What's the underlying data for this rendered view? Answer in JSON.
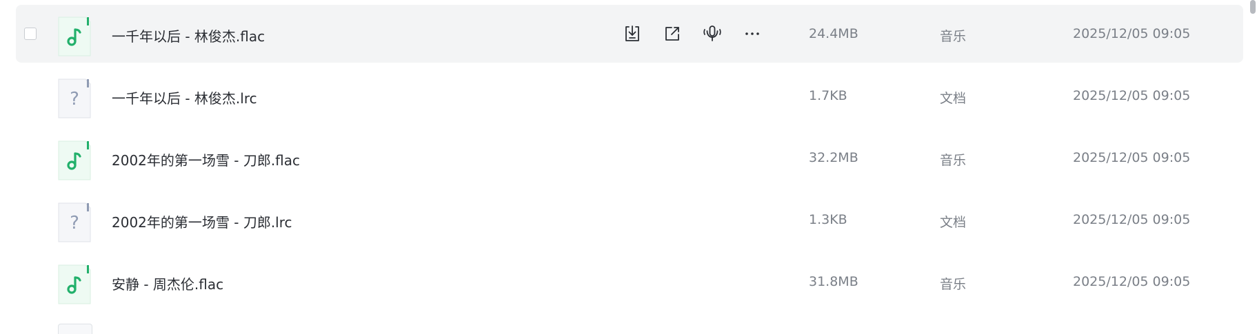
{
  "files": [
    {
      "name": "一千年以后 - 林俊杰.flac",
      "size": "24.4MB",
      "type": "音乐",
      "date": "2025/12/05 09:05",
      "icon": "music-file-icon",
      "hovered": true
    },
    {
      "name": "一千年以后 - 林俊杰.lrc",
      "size": "1.7KB",
      "type": "文档",
      "date": "2025/12/05 09:05",
      "icon": "unknown-file-icon",
      "hovered": false
    },
    {
      "name": "2002年的第一场雪 - 刀郎.flac",
      "size": "32.2MB",
      "type": "音乐",
      "date": "2025/12/05 09:05",
      "icon": "music-file-icon",
      "hovered": false
    },
    {
      "name": "2002年的第一场雪 - 刀郎.lrc",
      "size": "1.3KB",
      "type": "文档",
      "date": "2025/12/05 09:05",
      "icon": "unknown-file-icon",
      "hovered": false
    },
    {
      "name": "安静 - 周杰伦.flac",
      "size": "31.8MB",
      "type": "音乐",
      "date": "2025/12/05 09:05",
      "icon": "music-file-icon",
      "hovered": false
    }
  ],
  "row_actions": [
    "download-icon",
    "share-icon",
    "voice-icon",
    "more-icon"
  ],
  "colors": {
    "music_accent": "#22b06b",
    "hover_bg": "#f3f4f5",
    "text_primary": "#2a2d33",
    "text_secondary": "#7a7f87",
    "unknown_icon": "#8f9bb3"
  }
}
